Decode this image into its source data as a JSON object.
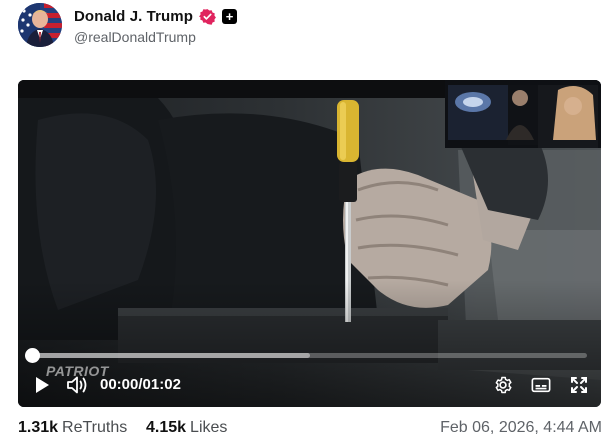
{
  "author": {
    "display_name": "Donald J. Trump",
    "handle": "@realDonaldTrump",
    "avatar_icon": "avatar-flag-portrait",
    "verified_icon": "verified-badge-icon",
    "verified_color": "#e0245e",
    "plus_icon": "plus-square-icon"
  },
  "video": {
    "current_time": "00:00",
    "duration": "01:02",
    "time_separator": "/",
    "progress_fraction": 0.0,
    "buffered_fraction": 0.5,
    "watermark": "PATRIOT",
    "controls": {
      "play_icon": "play-icon",
      "volume_icon": "volume-icon",
      "settings_icon": "gear-icon",
      "captions_icon": "captions-icon",
      "fullscreen_icon": "fullscreen-icon"
    }
  },
  "stats": {
    "retruths_count": "1.31k",
    "retruths_label": "ReTruths",
    "likes_count": "4.15k",
    "likes_label": "Likes",
    "timestamp": "Feb 06, 2026, 4:44 AM"
  }
}
